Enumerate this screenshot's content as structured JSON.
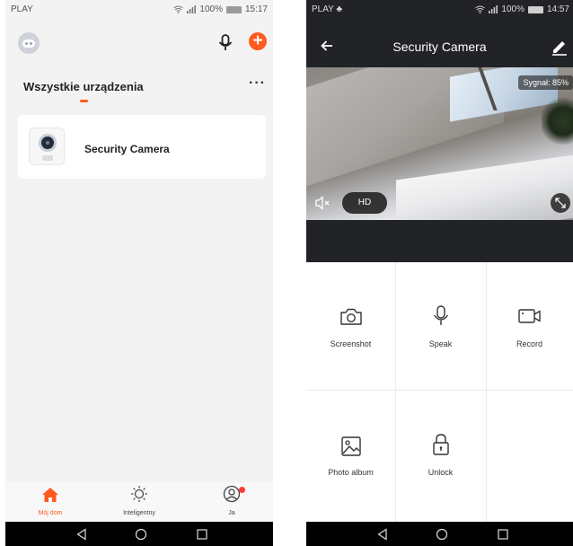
{
  "left_screen": {
    "status_bar": {
      "carrier": "PLAY",
      "battery": "100%",
      "time": "15:17"
    },
    "section_title": "Wszystkie urządzenia",
    "more_label": "···",
    "devices": [
      {
        "name": "Security Camera"
      }
    ],
    "tabs": [
      {
        "label": "Mój dom",
        "icon": "home-icon",
        "active": true
      },
      {
        "label": "Inteligentny",
        "icon": "sun-icon",
        "active": false
      },
      {
        "label": "Ja",
        "icon": "profile-icon",
        "active": false
      }
    ],
    "accent_color": "#ff5a1f"
  },
  "right_screen": {
    "status_bar": {
      "carrier": "PLAY",
      "battery": "100%",
      "time": "14:57"
    },
    "title": "Security Camera",
    "signal_label": "Sygnał: 85%",
    "quality_label": "HD",
    "actions": [
      {
        "label": "Screenshot",
        "icon": "camera-icon"
      },
      {
        "label": "Speak",
        "icon": "microphone-icon"
      },
      {
        "label": "Record",
        "icon": "video-record-icon"
      },
      {
        "label": "Photo album",
        "icon": "image-icon"
      },
      {
        "label": "Unlock",
        "icon": "lock-icon"
      }
    ]
  }
}
